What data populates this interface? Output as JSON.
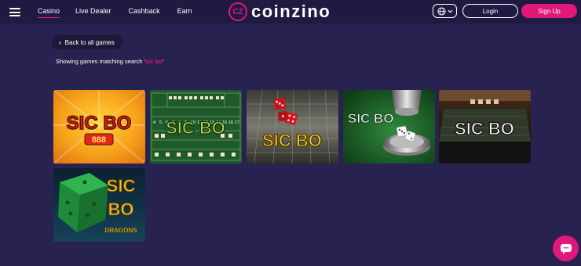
{
  "header": {
    "nav": [
      "Casino",
      "Live Dealer",
      "Cashback",
      "Earn"
    ],
    "active_nav": "Casino",
    "logo_badge": "CZ",
    "logo_text": "coinzino",
    "login_label": "Login",
    "signup_label": "Sign Up",
    "icons": {
      "menu": "hamburger-icon",
      "language": "globe-icon",
      "dropdown": "chevron-down-icon"
    }
  },
  "back_label": "Back to all games",
  "search": {
    "prefix": "Showing games matching search '",
    "term": "sic bo",
    "suffix": "'"
  },
  "games": [
    {
      "title_line1": "SIC BO",
      "title_line2": "888"
    },
    {
      "title_line1": "SIC BO",
      "board_numbers": [
        "4",
        "5",
        "6",
        "7",
        "8",
        "9",
        "10",
        "11",
        "12",
        "13",
        "14",
        "15",
        "16",
        "17"
      ]
    },
    {
      "title_line1": "SIC BO"
    },
    {
      "title_line1": "SIC BO"
    },
    {
      "title_line1": "SIC BO"
    },
    {
      "title_line1": "SIC",
      "title_line2": "BO",
      "title_line3": "DRAGONS"
    }
  ],
  "colors": {
    "background": "#27224f",
    "header": "#1e1a42",
    "accent": "#e0187a"
  }
}
